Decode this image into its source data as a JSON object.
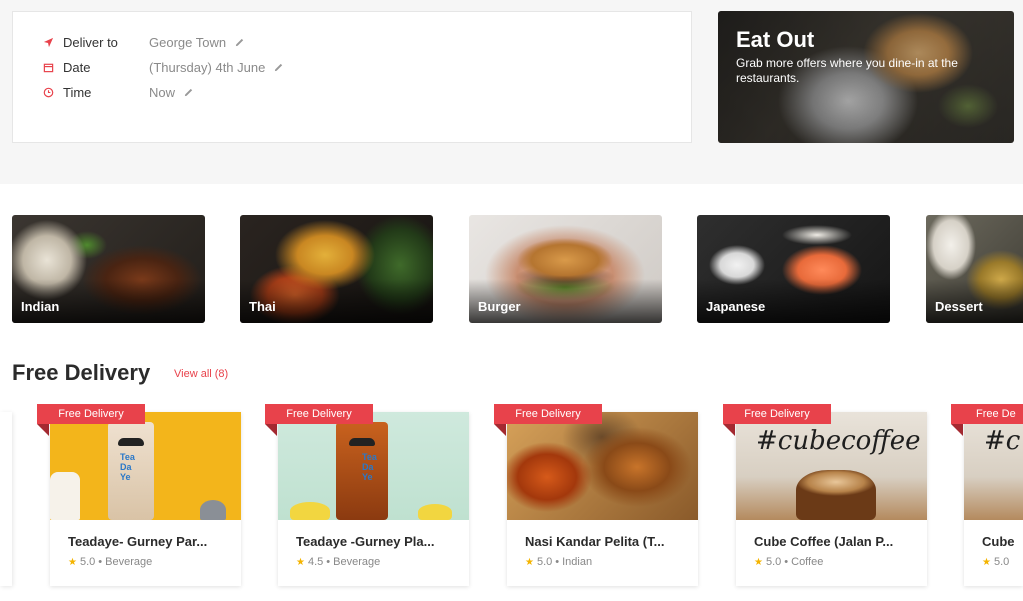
{
  "delivery": {
    "rows": [
      {
        "label": "Deliver to",
        "value": "George Town"
      },
      {
        "label": "Date",
        "value": "(Thursday) 4th June"
      },
      {
        "label": "Time",
        "value": "Now"
      }
    ]
  },
  "promo": {
    "title": "Eat Out",
    "subtitle": "Grab more offers where you dine-in at the restaurants."
  },
  "cuisines": [
    {
      "name": "Indian"
    },
    {
      "name": "Thai"
    },
    {
      "name": "Burger"
    },
    {
      "name": "Japanese"
    },
    {
      "name": "Dessert"
    }
  ],
  "section": {
    "title": "Free Delivery",
    "view_all": "View all (8)"
  },
  "restaurants": [
    {
      "badge": "Free Delivery",
      "name": "Teadaye- Gurney Par...",
      "rating": "5.0",
      "category": "Beverage",
      "tea_text": "Tea Da Ye"
    },
    {
      "badge": "Free Delivery",
      "name": "Teadaye -Gurney Pla...",
      "rating": "4.5",
      "category": "Beverage",
      "tea_text": "Tea Da Ye"
    },
    {
      "badge": "Free Delivery",
      "name": "Nasi Kandar Pelita (T...",
      "rating": "5.0",
      "category": "Indian"
    },
    {
      "badge": "Free Delivery",
      "name": "Cube Coffee (Jalan P...",
      "rating": "5.0",
      "category": "Coffee",
      "img_text": "#cubecoffee"
    },
    {
      "badge": "Free De",
      "name": "Cube",
      "rating": "5.0",
      "category": "",
      "img_text": "#c"
    }
  ],
  "colors": {
    "accent": "#e8424b",
    "star": "#f4b400"
  }
}
